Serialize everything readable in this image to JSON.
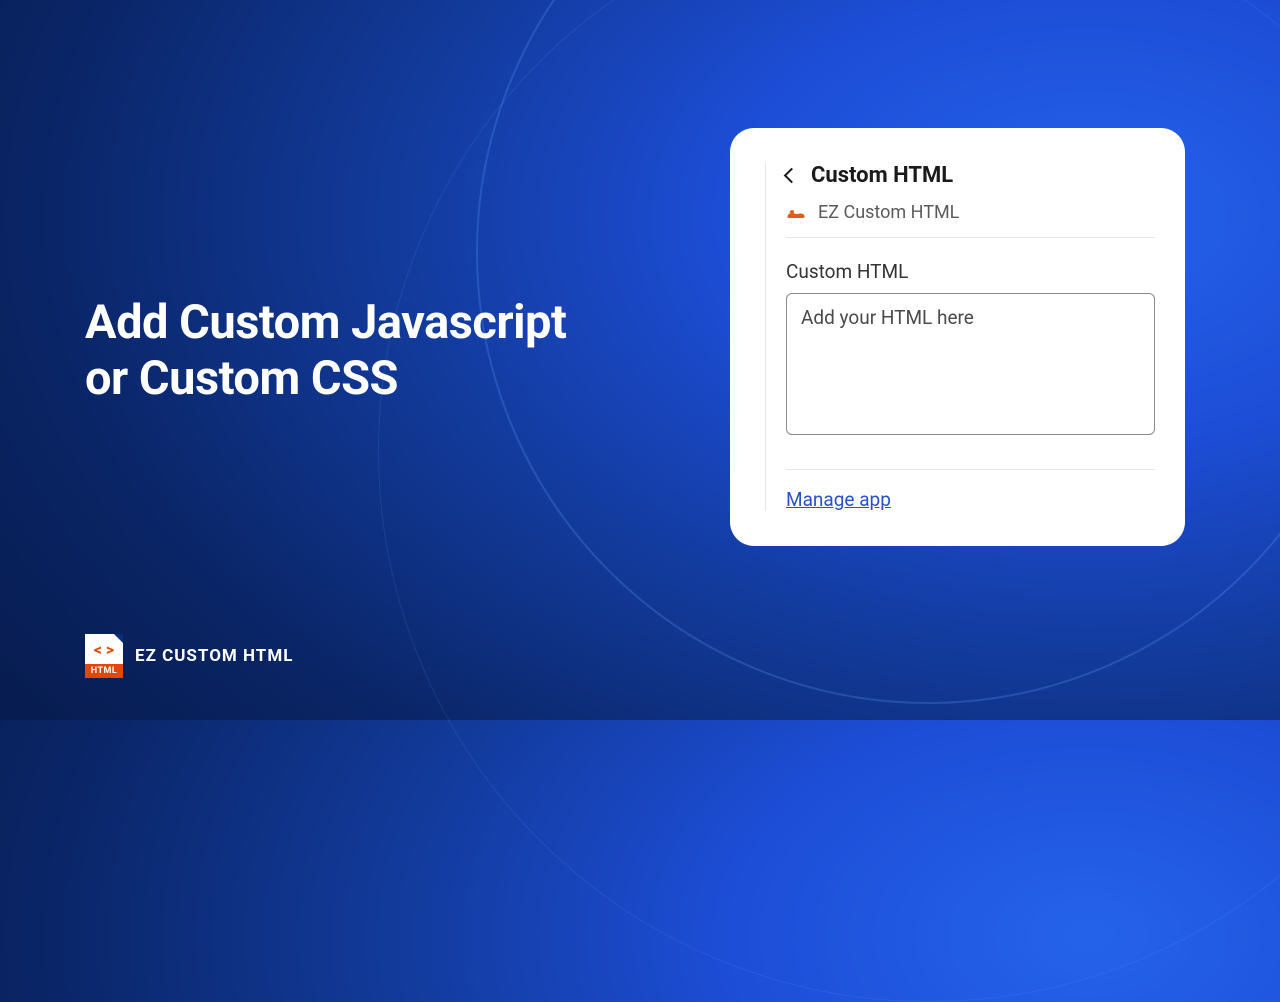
{
  "headline": {
    "line1": "Add Custom Javascript",
    "line2": "or Custom CSS"
  },
  "brand": {
    "icon_top": "< >",
    "icon_bottom": "HTML",
    "text": "EZ CUSTOM HTML"
  },
  "card": {
    "title": "Custom HTML",
    "app_name": "EZ Custom HTML",
    "field_label": "Custom HTML",
    "textarea_placeholder": "Add your HTML here",
    "textarea_value": "",
    "manage_link": "Manage app"
  }
}
